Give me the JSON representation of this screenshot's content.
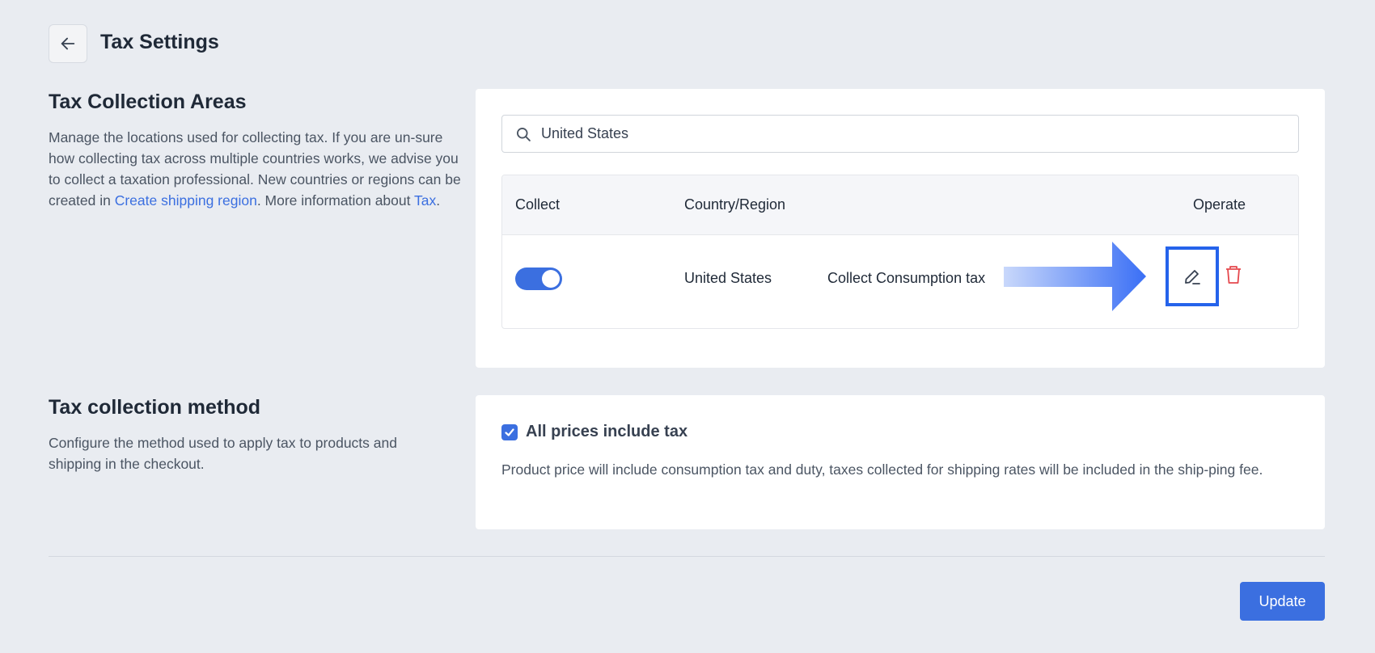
{
  "header": {
    "title": "Tax Settings"
  },
  "areas": {
    "title": "Tax Collection Areas",
    "desc_part1": "Manage the locations used for collecting tax. If you are un-sure how collecting tax across multiple countries works, we advise you to collect a taxation professional. New countries or regions can be created in ",
    "link_shipping": "Create shipping region",
    "desc_part2": ". More information about ",
    "link_tax": "Tax",
    "desc_part3": ".",
    "search": {
      "value": "United States",
      "placeholder": ""
    },
    "table": {
      "headers": {
        "collect": "Collect",
        "country": "Country/Region",
        "operate": "Operate"
      },
      "rows": [
        {
          "collect_enabled": true,
          "country": "United States",
          "tax_type": "Collect Consumption tax"
        }
      ]
    }
  },
  "method": {
    "title": "Tax collection method",
    "desc": "Configure the method used to apply tax to products and shipping in the checkout.",
    "checkbox_label": "All prices include tax",
    "checkbox_checked": true,
    "info": "Product price will include consumption tax and duty, taxes collected for shipping rates will be included in the ship-ping fee."
  },
  "footer": {
    "update_label": "Update"
  },
  "colors": {
    "accent": "#3b6fe0",
    "highlight": "#2563eb",
    "danger": "#e5484d",
    "background": "#e9ecf1"
  }
}
